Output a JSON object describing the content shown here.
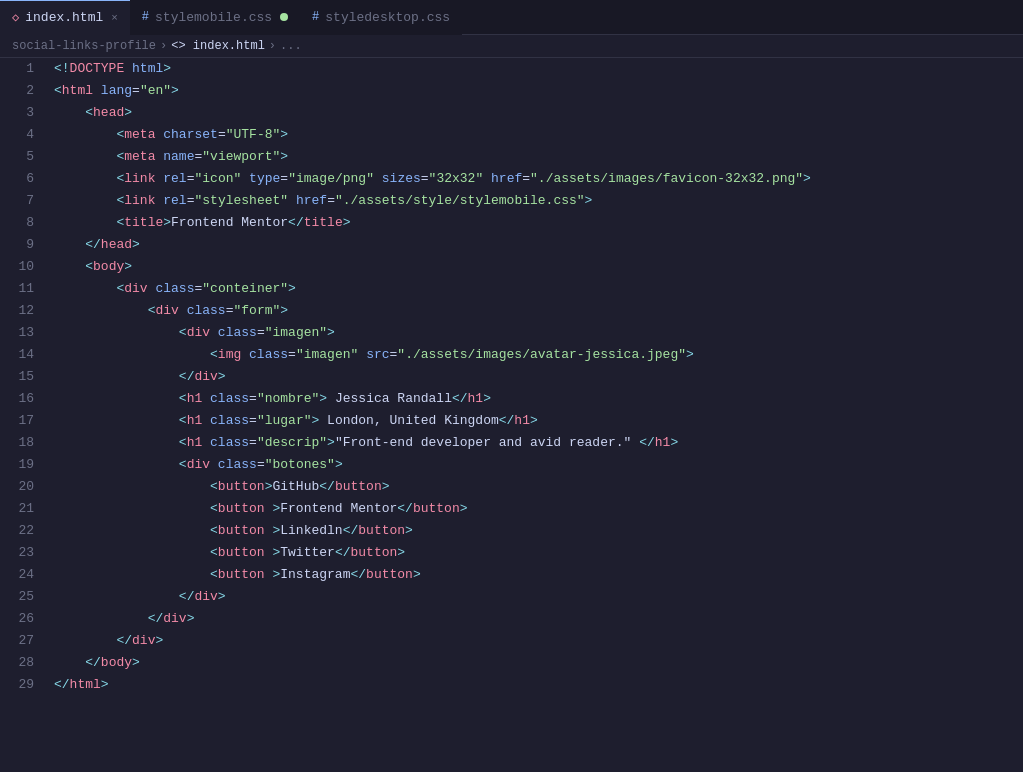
{
  "tabs": [
    {
      "id": "index-html",
      "label": "index.html",
      "type": "html",
      "state": "active",
      "close": "×"
    },
    {
      "id": "stylemobile-css",
      "label": "stylemobile.css",
      "type": "css",
      "state": "modified",
      "close": ""
    },
    {
      "id": "styledesktop-css",
      "label": "styledesktop.css",
      "type": "css",
      "state": "inactive",
      "close": ""
    }
  ],
  "breadcrumb": {
    "parts": [
      "social-links-profile",
      ">",
      "<> index.html",
      ">",
      "..."
    ]
  },
  "lines": [
    "1",
    "2",
    "3",
    "4",
    "5",
    "6",
    "7",
    "8",
    "9",
    "10",
    "11",
    "12",
    "13",
    "14",
    "15",
    "16",
    "17",
    "18",
    "19",
    "20",
    "21",
    "22",
    "23",
    "24",
    "25",
    "26",
    "27",
    "28",
    "29"
  ]
}
